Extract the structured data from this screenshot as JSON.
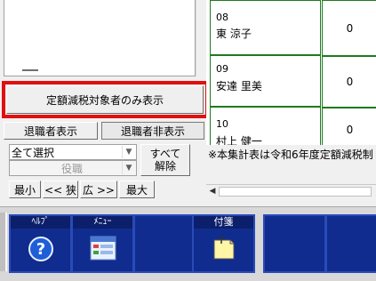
{
  "left_panel": {
    "fixed_tax_only_button": "定額減税対象者のみ表示",
    "show_retired_button": "退職者表示",
    "hide_retired_button": "退職者非表示",
    "select_combo_value": "全て選択",
    "role_combo_value": "役職",
    "clear_all_button_line1": "すべて",
    "clear_all_button_line2": "解除",
    "zoom_buttons": {
      "min": "最小",
      "narrow": "<< 狭",
      "wide": "広 >>",
      "max": "最大"
    }
  },
  "employee_grid": {
    "rows": [
      {
        "code": "08",
        "name": "東 涼子",
        "value": "0"
      },
      {
        "code": "09",
        "name": "安達 里美",
        "value": "0"
      },
      {
        "code": "10",
        "name": "村上 健一",
        "value": "0"
      }
    ],
    "note": "※本集計表は令和6年度定額減税制"
  },
  "bottom_toolbar": {
    "buttons": [
      {
        "label": "ﾍﾙﾌﾟ",
        "icon": "help-icon"
      },
      {
        "label": "ﾒﾆｭｰ",
        "icon": "menu-icon"
      },
      {
        "label": "",
        "icon": ""
      },
      {
        "label": "付箋",
        "icon": "sticky-note-icon"
      },
      {
        "label": "",
        "icon": ""
      },
      {
        "label": "",
        "icon": ""
      }
    ]
  },
  "colors": {
    "highlight_border": "#e01010",
    "grid_line": "#1f7a1f",
    "function_button_bg": "#102c8e"
  }
}
